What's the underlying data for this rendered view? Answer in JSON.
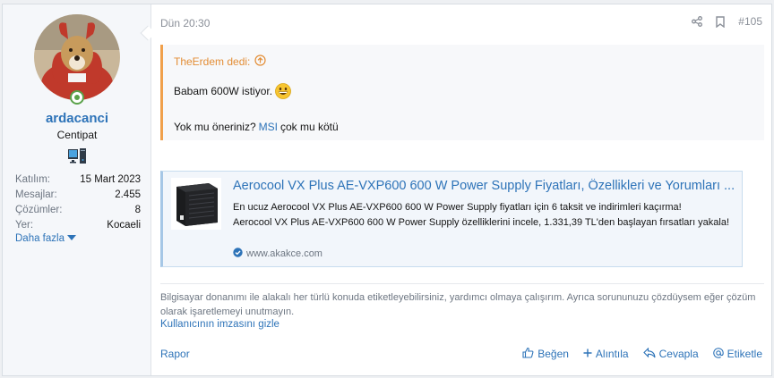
{
  "user": {
    "name": "ardacanci",
    "title": "Centipat",
    "stats": [
      {
        "key": "Katılım:",
        "value": "15 Mart 2023"
      },
      {
        "key": "Mesajlar:",
        "value": "2.455"
      },
      {
        "key": "Çözümler:",
        "value": "8"
      },
      {
        "key": "Yer:",
        "value": "Kocaeli"
      }
    ],
    "more_label": "Daha fazla"
  },
  "post": {
    "date": "Dün 20:30",
    "number": "#105"
  },
  "quote": {
    "author": "TheErdem dedi:",
    "line1": "Babam 600W istiyor.",
    "line2_before": "Yok mu öneriniz?",
    "line2_link": "MSI",
    "line2_after": "çok mu kötü"
  },
  "embed": {
    "title": "Aerocool VX Plus AE-VXP600 600 W Power Supply Fiyatları, Özellikleri ve Yorumları ...",
    "desc1": "En ucuz Aerocool VX Plus AE-VXP600 600 W Power Supply fiyatları için 6 taksit ve indirimleri kaçırma!",
    "desc2": "Aerocool VX Plus AE-VXP600 600 W Power Supply özelliklerini incele, 1.331,39 TL'den başlayan fırsatları yakala!",
    "source": "www.akakce.com"
  },
  "signature": {
    "text": "Bilgisayar donanımı ile alakalı her türlü konuda etiketleyebilirsiniz, yardımcı olmaya çalışırım. Ayrıca sorununuzu çözdüysem eğer çözüm olarak işaretlemeyi unutmayın.",
    "hide_label": "Kullanıcının imzasını gizle"
  },
  "footer": {
    "report": "Rapor",
    "like": "Beğen",
    "quote": "Alıntıla",
    "reply": "Cevapla",
    "tag": "Etiketle"
  },
  "colors": {
    "link": "#2d73b8",
    "quote_accent": "#f0a04b",
    "online": "#5aa24a"
  }
}
